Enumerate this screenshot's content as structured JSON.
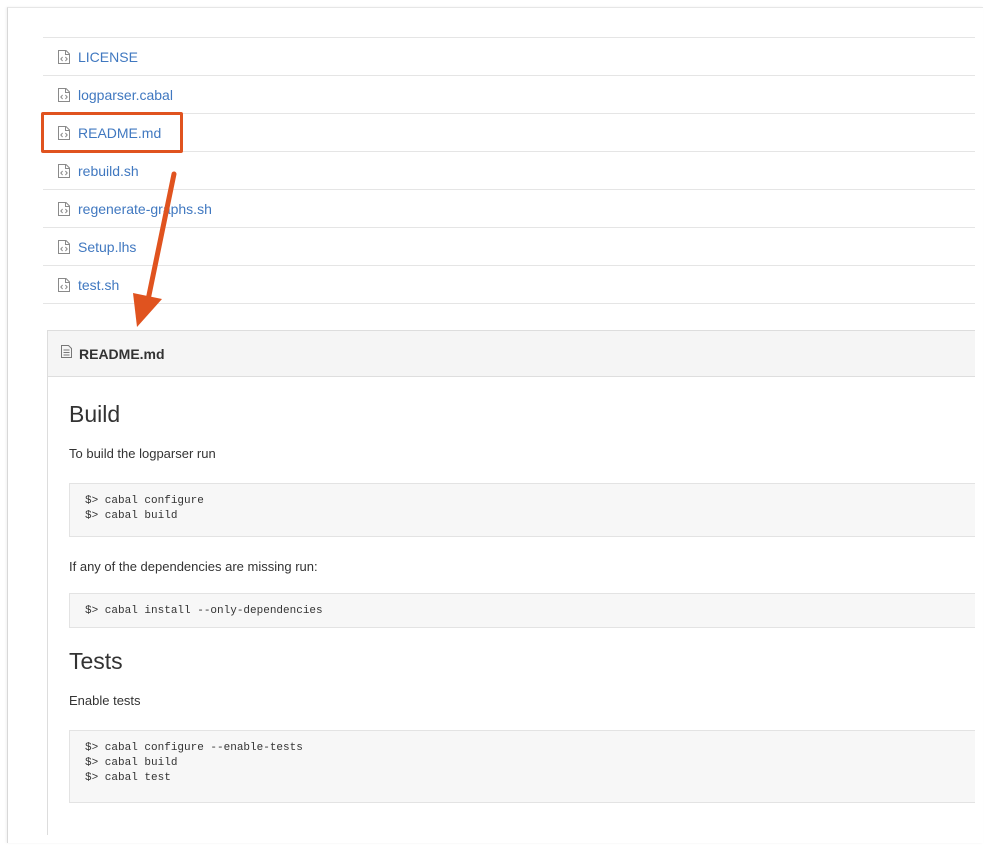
{
  "files": [
    {
      "name": "LICENSE"
    },
    {
      "name": "logparser.cabal"
    },
    {
      "name": "README.md"
    },
    {
      "name": "rebuild.sh"
    },
    {
      "name": "regenerate-graphs.sh"
    },
    {
      "name": "Setup.lhs"
    },
    {
      "name": "test.sh"
    }
  ],
  "readme": {
    "title": "README.md",
    "build_heading": "Build",
    "build_intro": "To build the logparser run",
    "build_code": [
      "$> cabal configure",
      "$> cabal build"
    ],
    "deps_intro": "If any of the dependencies are missing run:",
    "deps_code": [
      "$> cabal install --only-dependencies"
    ],
    "tests_heading": "Tests",
    "tests_intro": "Enable tests",
    "tests_code": [
      "$> cabal configure --enable-tests",
      "$> cabal build",
      "$> cabal test"
    ]
  },
  "colors": {
    "link": "#4078c0",
    "annotation": "#e0531f"
  }
}
